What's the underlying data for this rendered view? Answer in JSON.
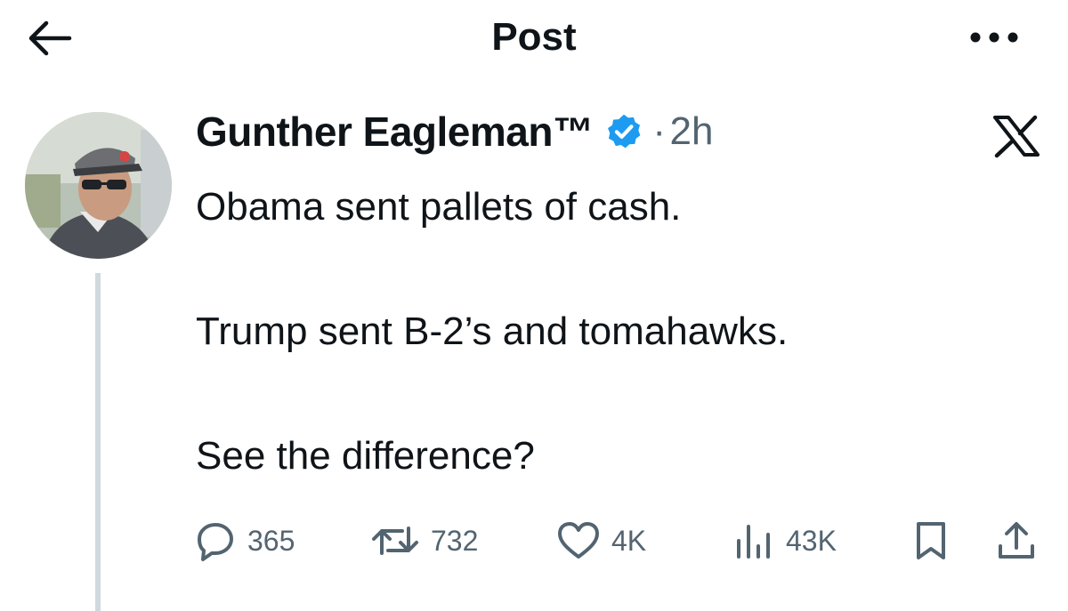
{
  "header": {
    "title": "Post",
    "back_icon": "arrow-left-icon",
    "more_icon": "more-horizontal-icon"
  },
  "post": {
    "author_name": "Gunther Eagleman™",
    "verified": true,
    "separator": "·",
    "time": "2h",
    "platform_icon": "x-logo-icon",
    "text": "Obama sent pallets of cash.\n\nTrump sent B-2’s and tomahawks.\n\nSee the difference?"
  },
  "actions": {
    "replies": "365",
    "reposts": "732",
    "likes": "4K",
    "views": "43K"
  },
  "colors": {
    "text": "#0f1419",
    "muted": "#536471",
    "verified_blue": "#1d9bf0",
    "thread_line": "#cfd9de"
  }
}
